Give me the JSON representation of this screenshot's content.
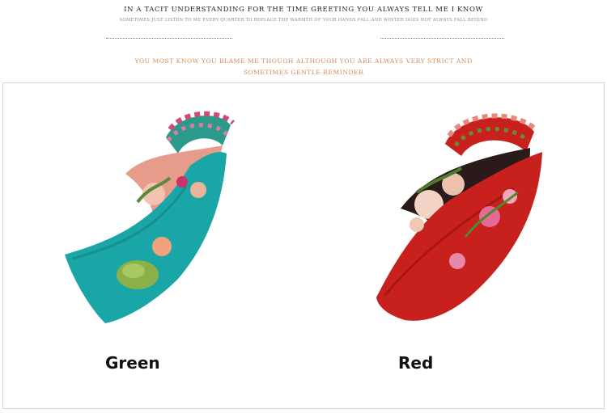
{
  "header": {
    "title": "IN A TACIT UNDERSTANDING FOR THE TIME GREETING YOU ALWAYS TELL ME I KNOW",
    "subtitle": "SOMETIMES JUST LISTEN TO ME EVERY QUARTER TO REPLACE THE WARMTH OF YOUR HANDS FALL AND WINTER DOES NOT ALWAYS FALL BEHIND",
    "tagline_line1": "YOU MOST KNOW YOU BLAME ME THOUGH ALTHOUGH YOU ARE ALWAYS VERY STRICT AND",
    "tagline_line2": "SOMETIMES GENTLE REMINDER"
  },
  "products": [
    {
      "label": "Green",
      "color": "#1aa6a6",
      "icon": "floral-headband-green"
    },
    {
      "label": "Red",
      "color": "#c8201c",
      "icon": "floral-headband-red"
    }
  ],
  "colors": {
    "tagline": "#d58a55",
    "teal": "#1aa6a6",
    "red": "#c8201c"
  }
}
